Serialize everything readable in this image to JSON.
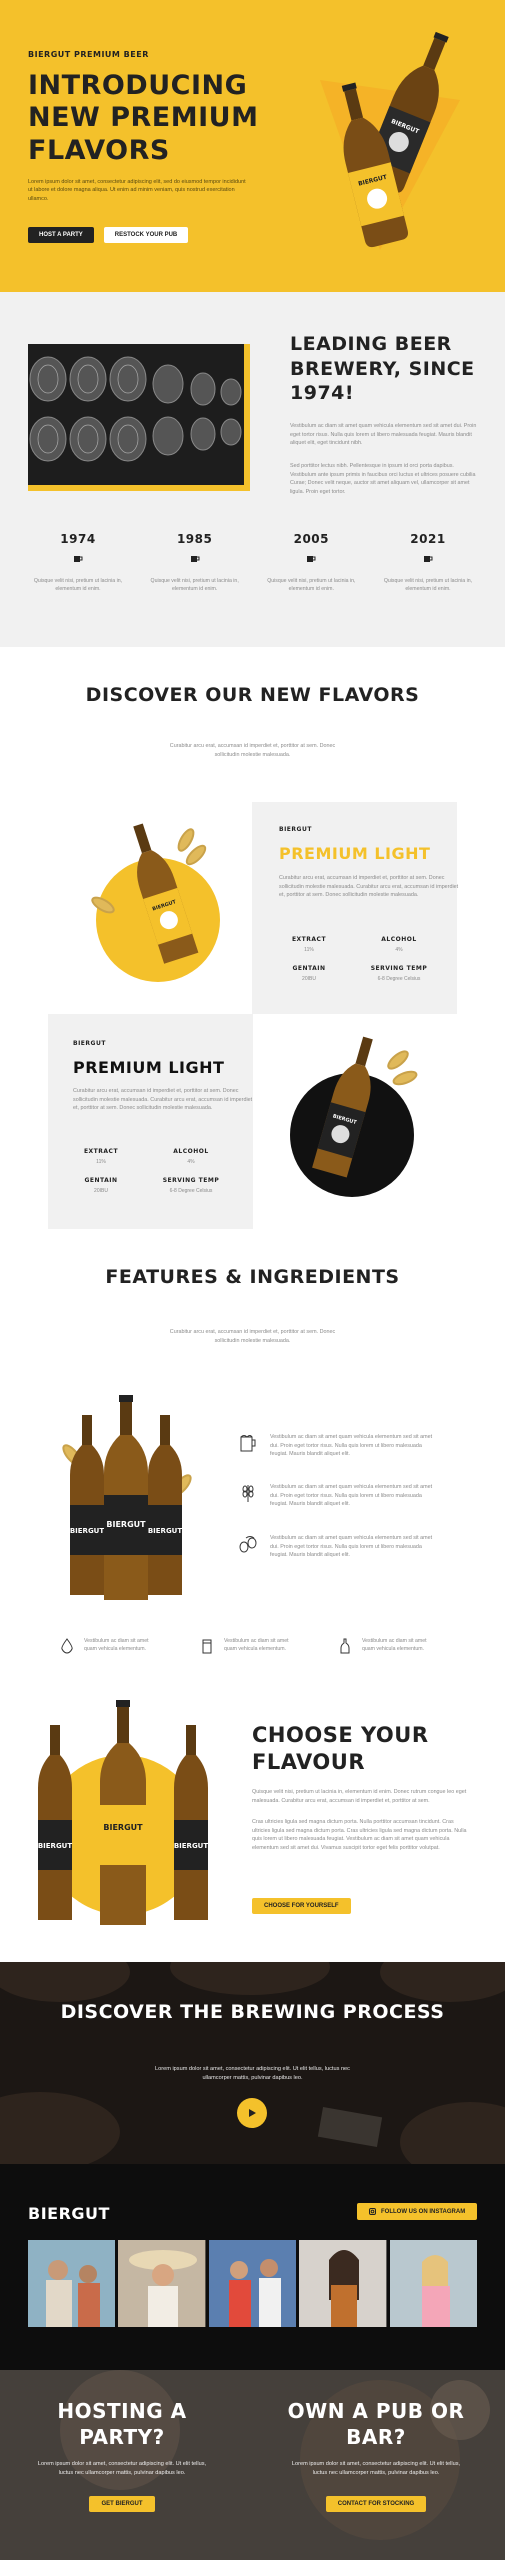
{
  "hero": {
    "eyebrow": "BIERGUT PREMIUM BEER",
    "title": "INTRODUCING NEW PREMIUM FLAVORS",
    "body": "Lorem ipsum dolor sit amet, consectetur adipiscing elit, sed do eiusmod tempor incididunt ut labore et dolore magna aliqua. Ut enim ad minim veniam, quis nostrud exercitation ullamco.",
    "host_button": "HOST A PARTY",
    "restock_button": "RESTOCK YOUR PUB",
    "bottle_label": "BIERGUT"
  },
  "story": {
    "title": "LEADING BEER BREWERY, SINCE 1974!",
    "p1": "Vestibulum ac diam sit amet quam vehicula elementum sed sit amet dui. Proin eget tortor risus. Nulla quis lorem ut libero malesuada feugiat. Mauris blandit aliquet elit, eget tincidunt nibh.",
    "p2": "Sed porttitor lectus nibh. Pellentesque in ipsum id orci porta dapibus. Vestibulum ante ipsum primis in faucibus orci luctus et ultrices posuere cubilia Curae; Donec velit neque, auctor sit amet aliquam vel, ullamcorper sit amet ligula. Proin eget tortor.",
    "timeline": [
      {
        "year": "1974",
        "text": "Quisque velit nisi, pretium ut lacinia in, elementum id enim."
      },
      {
        "year": "1985",
        "text": "Quisque velit nisi, pretium ut lacinia in, elementum id enim."
      },
      {
        "year": "2005",
        "text": "Quisque velit nisi, pretium ut lacinia in, elementum id enim."
      },
      {
        "year": "2021",
        "text": "Quisque velit nisi, pretium ut lacinia in, elementum id enim."
      }
    ]
  },
  "discover": {
    "title": "DISCOVER OUR NEW FLAVORS",
    "sub": "Curabitur arcu erat, accumsan id imperdiet et, porttitor at sem. Donec sollicitudin molestie malesuada."
  },
  "card1": {
    "brand": "BIERGUT",
    "name": "PREMIUM LIGHT",
    "desc": "Curabitur arcu erat, accumsan id imperdiet et, porttitor at sem. Donec sollicitudin molestie malesuada. Curabitur arcu erat, accumsan id imperdiet et, porttitor at sem. Donec sollicitudin molestie malesuada.",
    "specs": [
      {
        "label": "EXTRACT",
        "value": "11%"
      },
      {
        "label": "ALCOHOL",
        "value": "4%"
      },
      {
        "label": "GENTAIN",
        "value": "20IBU"
      },
      {
        "label": "SERVING TEMP",
        "value": "6-8 Degree Celsius"
      }
    ],
    "bottle_label": "BIERGUT"
  },
  "card2": {
    "brand": "BIERGUT",
    "name": "PREMIUM LIGHT",
    "desc": "Curabitur arcu erat, accumsan id imperdiet et, porttitor at sem. Donec sollicitudin molestie malesuada. Curabitur arcu erat, accumsan id imperdiet et, porttitor at sem. Donec sollicitudin molestie malesuada.",
    "specs": [
      {
        "label": "EXTRACT",
        "value": "11%"
      },
      {
        "label": "ALCOHOL",
        "value": "4%"
      },
      {
        "label": "GENTAIN",
        "value": "20IBU"
      },
      {
        "label": "SERVING TEMP",
        "value": "6-8 Degree Celsius"
      }
    ],
    "bottle_label": "BIERGUT"
  },
  "features": {
    "title": "FEATURES & INGREDIENTS",
    "sub": "Curabitur arcu erat, accumsan id imperdiet et, porttitor at sem. Donec sollicitudin molestie malesuada.",
    "bottle_label": "BIERGUT",
    "rows": [
      {
        "icon": "beer-mug-icon",
        "text": "Vestibulum ac diam sit amet quam vehicula elementum sed sit amet dui. Proin eget tortor risus. Nulla quis lorem ut libero malesuada feugiat. Mauris blandit aliquet elit."
      },
      {
        "icon": "wheat-icon",
        "text": "Vestibulum ac diam sit amet quam vehicula elementum sed sit amet dui. Proin eget tortor risus. Nulla quis lorem ut libero malesuada feugiat. Mauris blandit aliquet elit."
      },
      {
        "icon": "hops-icon",
        "text": "Vestibulum ac diam sit amet quam vehicula elementum sed sit amet dui. Proin eget tortor risus. Nulla quis lorem ut libero malesuada feugiat. Mauris blandit aliquet elit."
      }
    ],
    "mini": [
      {
        "icon": "water-drop-icon",
        "text": "Vestibulum ac diam sit amet quam vehicula elementum."
      },
      {
        "icon": "can-icon",
        "text": "Vestibulum ac diam sit amet quam vehicula elementum."
      },
      {
        "icon": "bottle-icon",
        "text": "Vestibulum ac diam sit amet quam vehicula elementum."
      }
    ]
  },
  "choose": {
    "title": "CHOOSE YOUR FLAVOUR",
    "p1": "Quisque velit nisi, pretium ut lacinia in, elementum id enim. Donec rutrum congue leo eget malesuada. Curabitur arcu erat, accumsan id imperdiet et, porttitor at sem.",
    "p2": "Cras ultricies ligula sed magna dictum porta. Nulla porttitor accumsan tincidunt. Cras ultricies ligula sed magna dictum porta. Cras ultricies ligula sed magna dictum porta. Nulla quis lorem ut libero malesuada feugiat. Vestibulum ac diam sit amet quam vehicula elementum sed sit amet dui. Vivamus suscipit tortor eget felis porttitor volutpat.",
    "button": "CHOOSE FOR YOURSELF",
    "bottle_label": "BIERGUT"
  },
  "brewing": {
    "title": "DISCOVER THE BREWING PROCESS",
    "sub": "Lorem ipsum dolor sit amet, consectetur adipiscing elit. Ut elit tellus, luctus nec ullamcorper mattis, pulvinar dapibus leo."
  },
  "insta": {
    "logo": "BIERGUT",
    "follow": "FOLLOW US ON INSTAGRAM"
  },
  "bottom": {
    "party_title": "HOSTING A PARTY?",
    "party_body": "Lorem ipsum dolor sit amet, consectetur adipiscing elit. Ut elit tellus, luctus nec ullamcorper mattis, pulvinar dapibus leo.",
    "party_button": "GET BIERGUT",
    "pub_title": "OWN A PUB OR BAR?",
    "pub_body": "Lorem ipsum dolor sit amet, consectetur adipiscing elit. Ut elit tellus, luctus nec ullamcorper mattis, pulvinar dapibus leo.",
    "pub_button": "CONTACT FOR STOCKING"
  },
  "colors": {
    "accent": "#f4c12b",
    "dark": "#222222",
    "light_bg": "#f1f1f1"
  }
}
